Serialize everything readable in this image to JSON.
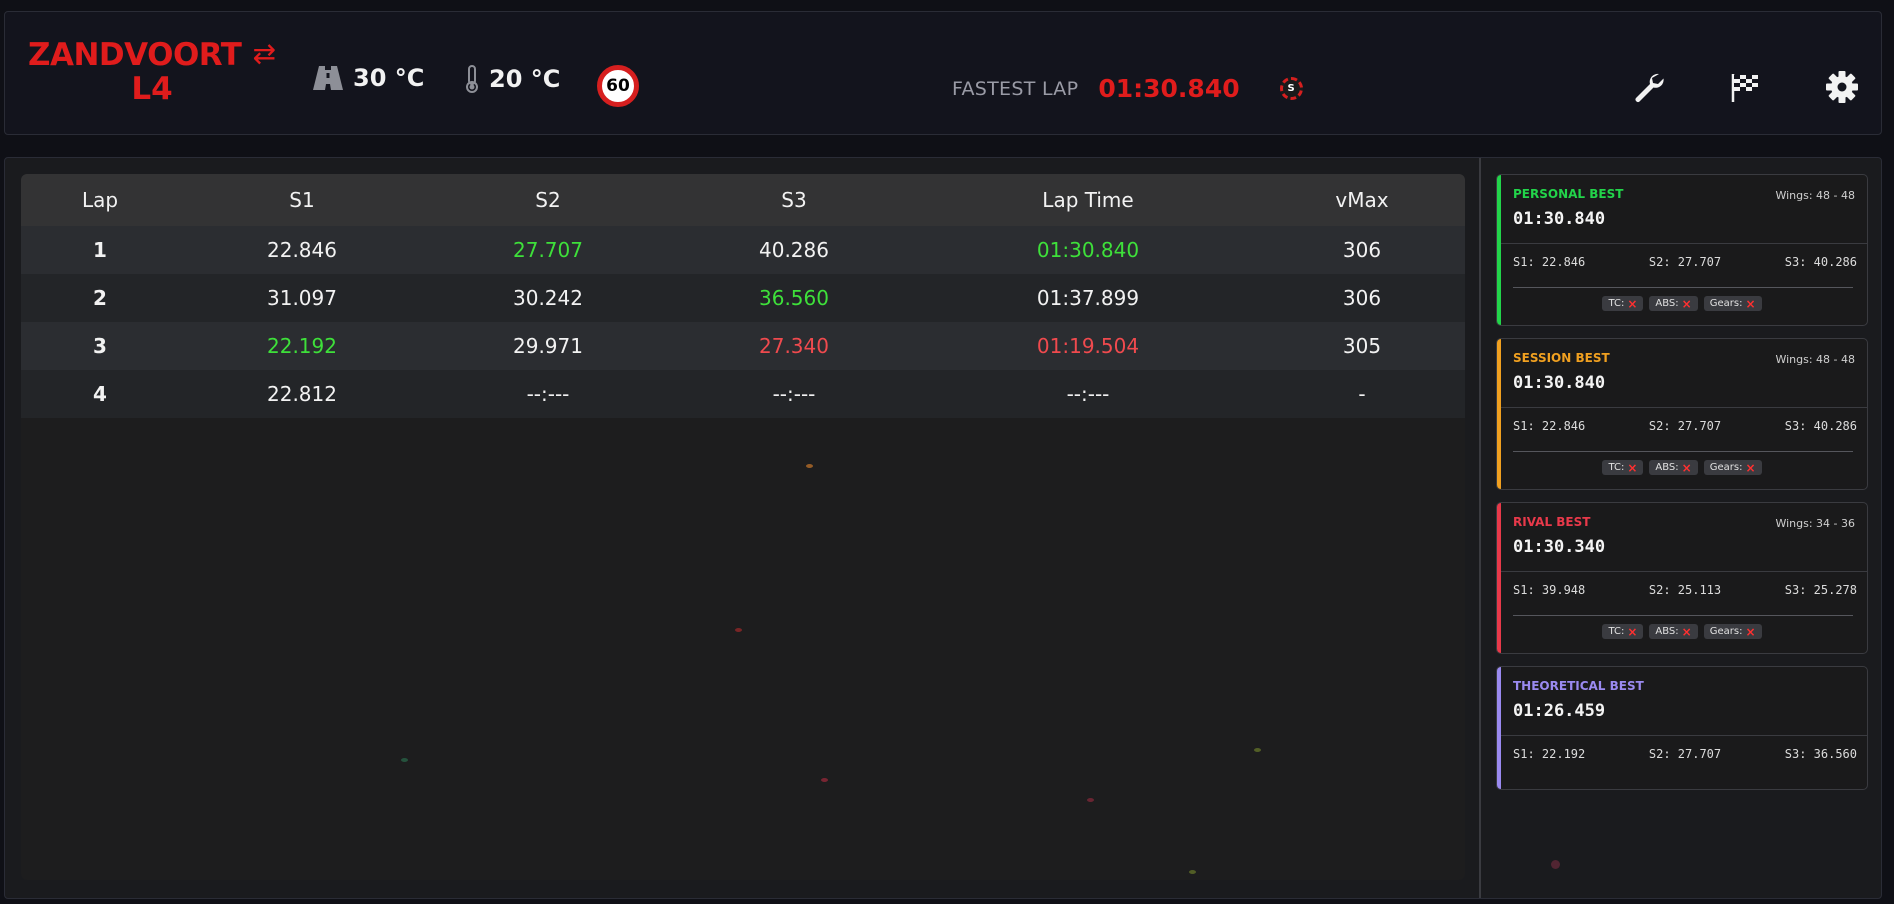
{
  "header": {
    "track": "ZANDVOORT",
    "swap_icon": "swap-arrows-icon",
    "lap": "L4",
    "air_temp": "30 °C",
    "track_temp": "20 °C",
    "speed_limit": "60",
    "fastest_label": "FASTEST LAP",
    "fastest_time": "01:30.840",
    "session_badge": "S",
    "icons": [
      "wrench-icon",
      "checkered-flag-icon",
      "gear-icon"
    ]
  },
  "table": {
    "columns": [
      "Lap",
      "S1",
      "S2",
      "S3",
      "Lap Time",
      "vMax"
    ],
    "rows": [
      {
        "lap": "1",
        "s1": "22.846",
        "s2": "27.707",
        "s3": "40.286",
        "time": "01:30.840",
        "vmax": "306"
      },
      {
        "lap": "2",
        "s1": "31.097",
        "s2": "30.242",
        "s3": "36.560",
        "time": "01:37.899",
        "vmax": "306"
      },
      {
        "lap": "3",
        "s1": "22.192",
        "s2": "29.971",
        "s3": "27.340",
        "time": "01:19.504",
        "vmax": "305"
      },
      {
        "lap": "4",
        "s1": "22.812",
        "s2": "--:---",
        "s3": "--:---",
        "time": "--:---",
        "vmax": "-"
      }
    ]
  },
  "colors": {
    "brand_red": "#e01c1c",
    "best_green": "#3ee03a",
    "worse_red": "#f04a4e",
    "personal": "#22d44a",
    "session": "#f0a020",
    "rival": "#e8394a",
    "theoretical": "#9a8af0"
  },
  "cards": [
    {
      "title": "PERSONAL BEST",
      "wings": "Wings: 48 - 48",
      "time": "01:30.840",
      "s1": "S1: 22.846",
      "s2": "S2: 27.707",
      "s3": "S3: 40.286",
      "tc": "TC:",
      "abs": "ABS:",
      "gears": "Gears:"
    },
    {
      "title": "SESSION BEST",
      "wings": "Wings: 48 - 48",
      "time": "01:30.840",
      "s1": "S1: 22.846",
      "s2": "S2: 27.707",
      "s3": "S3: 40.286",
      "tc": "TC:",
      "abs": "ABS:",
      "gears": "Gears:"
    },
    {
      "title": "RIVAL BEST",
      "wings": "Wings: 34 - 36",
      "time": "01:30.340",
      "s1": "S1: 39.948",
      "s2": "S2: 25.113",
      "s3": "S3: 25.278",
      "tc": "TC:",
      "abs": "ABS:",
      "gears": "Gears:"
    },
    {
      "title": "THEORETICAL BEST",
      "time": "01:26.459",
      "s1": "S1: 22.192",
      "s2": "S2: 27.707",
      "s3": "S3: 36.560"
    }
  ]
}
